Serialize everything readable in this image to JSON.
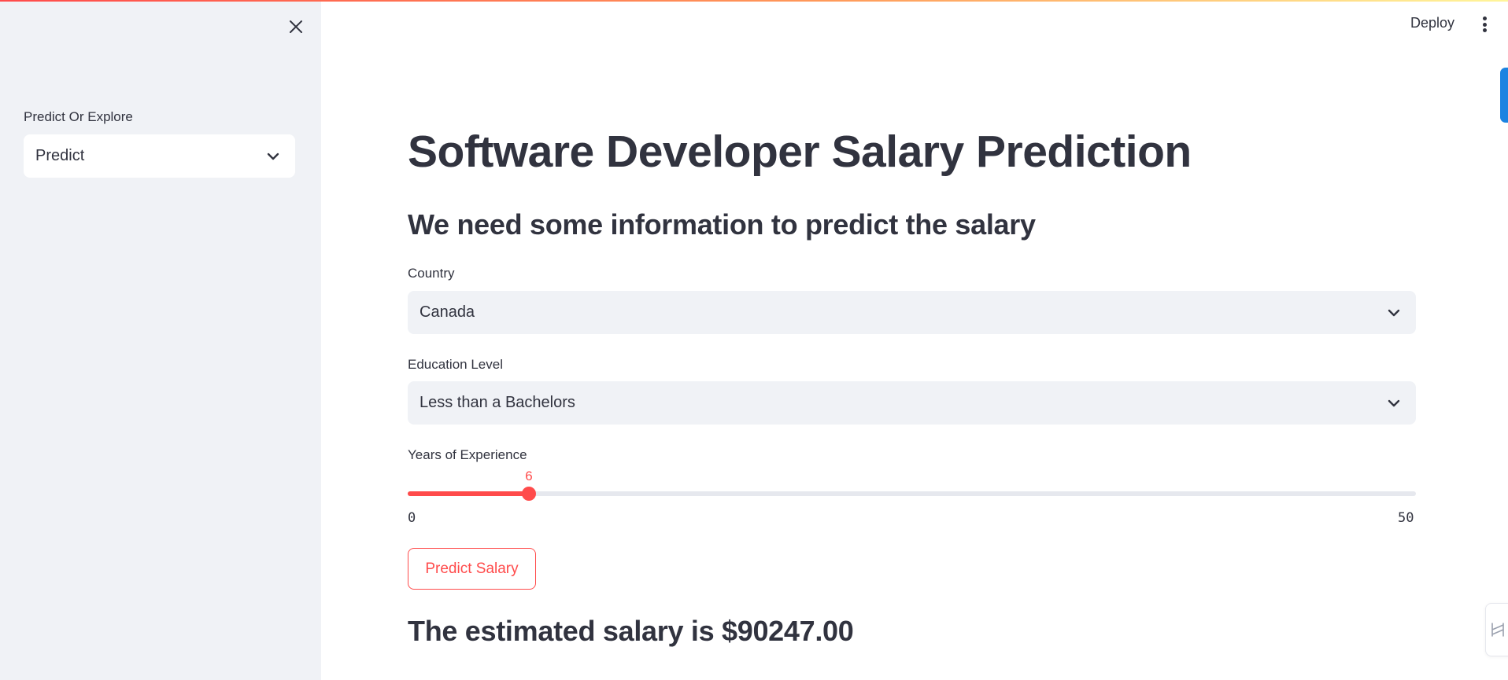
{
  "header": {
    "deploy_label": "Deploy",
    "menu_icon": "kebab-menu-icon"
  },
  "sidebar": {
    "close_icon": "close-icon",
    "label": "Predict Or Explore",
    "select_value": "Predict"
  },
  "main": {
    "title": "Software Developer Salary Prediction",
    "subheading": "We need some information to predict the salary",
    "country": {
      "label": "Country",
      "value": "Canada"
    },
    "education": {
      "label": "Education Level",
      "value": "Less than a Bachelors"
    },
    "experience": {
      "label": "Years of Experience",
      "value": "6",
      "min": "0",
      "max": "50",
      "fraction": 0.12
    },
    "predict_button": "Predict Salary",
    "result": "The estimated salary is $90247.00"
  },
  "colors": {
    "accent": "#ff4b4b",
    "sidebar_bg": "#f0f2f6",
    "text": "#31333f",
    "edge_tab": "#1c83e1"
  }
}
